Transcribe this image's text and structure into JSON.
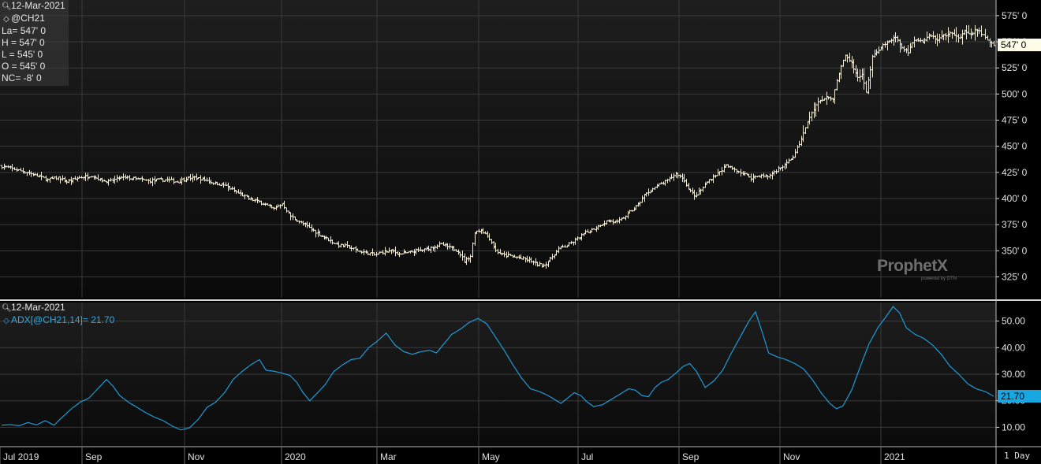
{
  "colors": {
    "background": "#000000",
    "panel_top": "#1e1e1e",
    "panel_bottom": "#0a0a0a",
    "grid": "#3a3a3a",
    "price_bars": "#f2ead2",
    "adx_line": "#1e9bd7",
    "adx_badge": "#19a7e2",
    "price_badge": "#fffde8",
    "axis_text": "#e0e0e0"
  },
  "legend_main": {
    "date": "12-Mar-2021",
    "symbol": "@CH21",
    "last": "La= 547' 0",
    "high": "H = 547' 0",
    "low": "L = 545' 0",
    "open": "O = 545' 0",
    "net_change": "NC= -8' 0",
    "icons": [
      "magnifier-icon",
      "diamond-icon"
    ]
  },
  "legend_adx": {
    "date": "12-Mar-2021",
    "study": "ADX[@CH21,14]= 21.70"
  },
  "watermark": {
    "brand": "ProphetX",
    "sub": "powered by DTN"
  },
  "timeframe": "1 Day",
  "chart_data": [
    {
      "type": "bar",
      "name": "price",
      "symbol": "@CH21",
      "y_ticks": [
        "575' 0",
        "550' 0",
        "525' 0",
        "500' 0",
        "475' 0",
        "450' 0",
        "425' 0",
        "400' 0",
        "375' 0",
        "350' 0",
        "325' 0"
      ],
      "y_tick_values": [
        575,
        550,
        525,
        500,
        475,
        450,
        425,
        400,
        375,
        350,
        325
      ],
      "ylim": [
        305,
        590
      ],
      "last_value_label": "547' 0",
      "last_value": 547,
      "x_months": [
        "Jul 2019",
        "Sep",
        "Nov",
        "2020",
        "Mar",
        "May",
        "Jul",
        "Sep",
        "Nov",
        "2021"
      ],
      "close_path": [
        [
          0,
          431
        ],
        [
          6,
          428
        ],
        [
          12,
          425
        ],
        [
          18,
          421
        ],
        [
          22,
          418
        ],
        [
          27,
          420
        ],
        [
          31,
          416
        ],
        [
          37,
          420
        ],
        [
          43,
          422
        ],
        [
          47,
          418
        ],
        [
          51,
          416
        ],
        [
          57,
          420
        ],
        [
          63,
          419
        ],
        [
          70,
          417
        ],
        [
          78,
          418
        ],
        [
          84,
          416
        ],
        [
          88,
          419
        ],
        [
          92,
          420
        ],
        [
          97,
          418
        ],
        [
          101,
          415
        ],
        [
          106,
          413
        ],
        [
          112,
          406
        ],
        [
          118,
          400
        ],
        [
          124,
          396
        ],
        [
          130,
          390
        ],
        [
          134,
          395
        ],
        [
          138,
          383
        ],
        [
          142,
          378
        ],
        [
          147,
          372
        ],
        [
          150,
          368
        ],
        [
          155,
          362
        ],
        [
          160,
          356
        ],
        [
          165,
          354
        ],
        [
          170,
          350
        ],
        [
          175,
          348
        ],
        [
          178,
          346
        ],
        [
          182,
          349
        ],
        [
          186,
          350
        ],
        [
          190,
          347
        ],
        [
          194,
          348
        ],
        [
          198,
          350
        ],
        [
          202,
          351
        ],
        [
          206,
          354
        ],
        [
          210,
          356
        ],
        [
          214,
          353
        ],
        [
          218,
          350
        ],
        [
          221,
          340
        ],
        [
          224,
          345
        ],
        [
          226,
          368
        ],
        [
          229,
          370
        ],
        [
          233,
          362
        ],
        [
          236,
          350
        ],
        [
          239,
          346
        ],
        [
          243,
          345
        ],
        [
          247,
          343
        ],
        [
          252,
          341
        ],
        [
          256,
          337
        ],
        [
          259,
          336
        ],
        [
          262,
          342
        ],
        [
          266,
          352
        ],
        [
          270,
          355
        ],
        [
          274,
          360
        ],
        [
          278,
          366
        ],
        [
          282,
          370
        ],
        [
          286,
          375
        ],
        [
          290,
          379
        ],
        [
          294,
          377
        ],
        [
          297,
          382
        ],
        [
          300,
          387
        ],
        [
          304,
          394
        ],
        [
          307,
          403
        ],
        [
          310,
          408
        ],
        [
          314,
          413
        ],
        [
          318,
          417
        ],
        [
          322,
          424
        ],
        [
          325,
          420
        ],
        [
          328,
          410
        ],
        [
          331,
          402
        ],
        [
          334,
          408
        ],
        [
          338,
          418
        ],
        [
          342,
          424
        ],
        [
          346,
          431
        ],
        [
          350,
          428
        ],
        [
          354,
          424
        ],
        [
          358,
          420
        ],
        [
          362,
          422
        ],
        [
          366,
          421
        ],
        [
          370,
          427
        ],
        [
          374,
          432
        ],
        [
          378,
          440
        ],
        [
          381,
          452
        ],
        [
          384,
          468
        ],
        [
          387,
          482
        ],
        [
          390,
          492
        ],
        [
          394,
          498
        ],
        [
          397,
          495
        ],
        [
          400,
          520
        ],
        [
          403,
          538
        ],
        [
          406,
          530
        ],
        [
          409,
          515
        ],
        [
          411,
          520
        ],
        [
          413,
          502
        ],
        [
          416,
          535
        ],
        [
          420,
          545
        ],
        [
          423,
          550
        ],
        [
          427,
          555
        ],
        [
          430,
          545
        ],
        [
          433,
          540
        ],
        [
          436,
          552
        ],
        [
          440,
          550
        ],
        [
          443,
          556
        ],
        [
          447,
          552
        ],
        [
          450,
          556
        ],
        [
          454,
          558
        ],
        [
          457,
          553
        ],
        [
          460,
          560
        ],
        [
          463,
          556
        ],
        [
          466,
          562
        ],
        [
          469,
          556
        ],
        [
          472,
          550
        ],
        [
          474,
          547
        ]
      ]
    },
    {
      "type": "line",
      "name": "ADX[@CH21,14]",
      "y_ticks": [
        "50.00",
        "40.00",
        "30.00",
        "20.00",
        "10.00"
      ],
      "y_tick_values": [
        50,
        40,
        30,
        20,
        10
      ],
      "ylim": [
        3,
        57
      ],
      "last_value_label": "21.70",
      "last_value": 21.7,
      "values_path": [
        [
          0,
          10.8
        ],
        [
          4,
          11.0
        ],
        [
          8,
          10.6
        ],
        [
          12,
          11.8
        ],
        [
          16,
          10.9
        ],
        [
          20,
          12.5
        ],
        [
          24,
          10.8
        ],
        [
          28,
          14.0
        ],
        [
          32,
          17.0
        ],
        [
          36,
          19.5
        ],
        [
          40,
          21.0
        ],
        [
          44,
          24.5
        ],
        [
          48,
          28.0
        ],
        [
          51,
          25.5
        ],
        [
          54,
          22.0
        ],
        [
          58,
          19.5
        ],
        [
          62,
          17.5
        ],
        [
          66,
          15.5
        ],
        [
          70,
          13.8
        ],
        [
          74,
          12.5
        ],
        [
          78,
          10.5
        ],
        [
          82,
          9.0
        ],
        [
          86,
          9.8
        ],
        [
          90,
          13.0
        ],
        [
          94,
          17.5
        ],
        [
          98,
          19.5
        ],
        [
          102,
          23.0
        ],
        [
          106,
          28.0
        ],
        [
          110,
          31.0
        ],
        [
          114,
          33.5
        ],
        [
          118,
          35.5
        ],
        [
          121,
          31.5
        ],
        [
          124,
          31.2
        ],
        [
          128,
          30.5
        ],
        [
          132,
          29.5
        ],
        [
          135,
          27.0
        ],
        [
          138,
          23.0
        ],
        [
          141,
          20.0
        ],
        [
          144,
          22.5
        ],
        [
          148,
          26.0
        ],
        [
          152,
          31.0
        ],
        [
          156,
          33.5
        ],
        [
          160,
          35.5
        ],
        [
          164,
          36.0
        ],
        [
          168,
          40.0
        ],
        [
          172,
          42.5
        ],
        [
          176,
          45.5
        ],
        [
          180,
          41.0
        ],
        [
          184,
          38.5
        ],
        [
          188,
          37.5
        ],
        [
          192,
          38.5
        ],
        [
          196,
          39.0
        ],
        [
          199,
          38.0
        ],
        [
          202,
          41.0
        ],
        [
          206,
          45.0
        ],
        [
          210,
          47.0
        ],
        [
          214,
          49.5
        ],
        [
          218,
          51.0
        ],
        [
          222,
          49.0
        ],
        [
          226,
          44.0
        ],
        [
          230,
          39.0
        ],
        [
          234,
          33.5
        ],
        [
          238,
          28.5
        ],
        [
          242,
          24.5
        ],
        [
          246,
          23.5
        ],
        [
          250,
          22.0
        ],
        [
          254,
          20.0
        ],
        [
          256,
          19.0
        ],
        [
          259,
          21.0
        ],
        [
          262,
          23.0
        ],
        [
          265,
          22.0
        ],
        [
          268,
          19.5
        ],
        [
          271,
          17.8
        ],
        [
          275,
          18.5
        ],
        [
          279,
          20.5
        ],
        [
          283,
          22.5
        ],
        [
          287,
          24.5
        ],
        [
          290,
          24.0
        ],
        [
          293,
          22.0
        ],
        [
          296,
          21.5
        ],
        [
          299,
          25.0
        ],
        [
          302,
          27.0
        ],
        [
          305,
          28.0
        ],
        [
          308,
          30.0
        ],
        [
          312,
          33.0
        ],
        [
          315,
          34.0
        ],
        [
          318,
          31.0
        ],
        [
          322,
          25.0
        ],
        [
          326,
          27.5
        ],
        [
          330,
          31.5
        ],
        [
          334,
          38.0
        ],
        [
          338,
          44.0
        ],
        [
          342,
          50.0
        ],
        [
          345,
          53.5
        ],
        [
          348,
          46.0
        ],
        [
          351,
          38.0
        ],
        [
          355,
          36.5
        ],
        [
          359,
          35.5
        ],
        [
          363,
          34.0
        ],
        [
          367,
          32.0
        ],
        [
          371,
          28.0
        ],
        [
          375,
          23.0
        ],
        [
          379,
          19.0
        ],
        [
          382,
          17.0
        ],
        [
          385,
          18.0
        ],
        [
          389,
          24.0
        ],
        [
          393,
          33.0
        ],
        [
          397,
          41.5
        ],
        [
          401,
          47.5
        ],
        [
          405,
          52.0
        ],
        [
          408,
          55.5
        ],
        [
          411,
          53.0
        ],
        [
          414,
          47.5
        ],
        [
          418,
          45.0
        ],
        [
          422,
          43.5
        ],
        [
          426,
          41.0
        ],
        [
          430,
          37.5
        ],
        [
          434,
          33.0
        ],
        [
          438,
          30.0
        ],
        [
          442,
          26.5
        ],
        [
          446,
          24.5
        ],
        [
          450,
          23.5
        ],
        [
          454,
          21.7
        ]
      ]
    }
  ]
}
